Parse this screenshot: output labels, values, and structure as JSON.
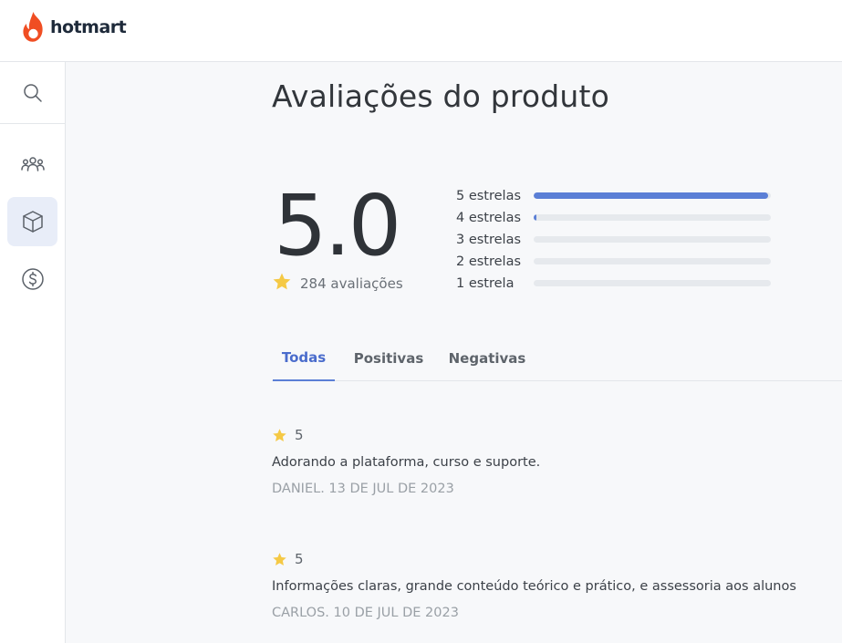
{
  "app": {
    "brand": "hotmart",
    "brand_color": "#f04e23"
  },
  "sidebar": {
    "items": [
      {
        "icon": "search-icon"
      },
      {
        "icon": "users-icon"
      },
      {
        "icon": "box-icon",
        "active": true
      },
      {
        "icon": "dollar-icon"
      }
    ]
  },
  "page": {
    "title": "Avaliações do produto"
  },
  "summary": {
    "score": "5.0",
    "count_label": "284 avaliações"
  },
  "distribution": [
    {
      "label": "5 estrelas",
      "fraction": 0.99
    },
    {
      "label": "4 estrelas",
      "fraction": 0.01
    },
    {
      "label": "3 estrelas",
      "fraction": 0
    },
    {
      "label": "2 estrelas",
      "fraction": 0
    },
    {
      "label": "1 estrela",
      "fraction": 0
    }
  ],
  "tabs": [
    {
      "label": "Todas",
      "active": true
    },
    {
      "label": "Positivas",
      "active": false
    },
    {
      "label": "Negativas",
      "active": false
    }
  ],
  "reviews": [
    {
      "rating": "5",
      "text": "Adorando a plataforma, curso e suporte.",
      "meta": "DANIEL. 13 DE JUL DE 2023"
    },
    {
      "rating": "5",
      "text": "Informações claras, grande conteúdo teórico e prático, e assessoria aos alunos",
      "meta": "CARLOS. 10 DE JUL DE 2023"
    }
  ],
  "colors": {
    "accent": "#5b7fd6",
    "star": "#f5c945",
    "bar_track": "#e6e9ed"
  }
}
